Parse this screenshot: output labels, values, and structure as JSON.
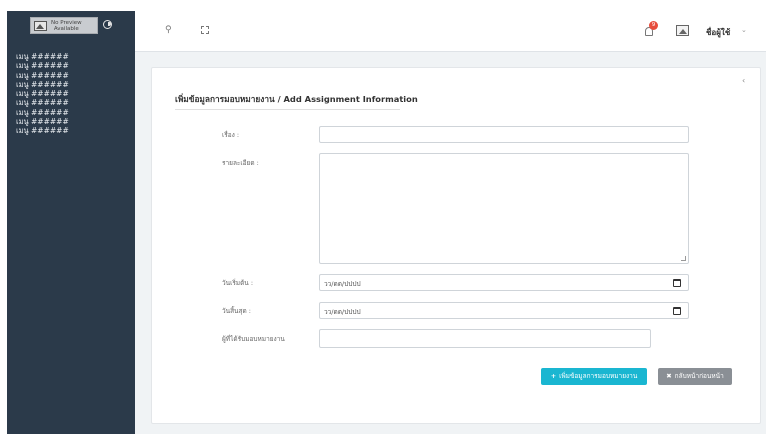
{
  "sidebar": {
    "logo_text_line1": "No Preview",
    "logo_text_line2": "Available",
    "menu_items": [
      "เมนู ######",
      "เมนู ######",
      "เมนู ######",
      "เมนู ######",
      "เมนู ######",
      "เมนู ######",
      "เมนู ######",
      "เมนู ######",
      "เมนู ######"
    ]
  },
  "topbar": {
    "notification_count": "9",
    "username": "ชื่อผู้ใช้",
    "user_caret": "⌄"
  },
  "form": {
    "title": "เพิ่มข้อมูลการมอบหมายงาน / Add Assignment Information",
    "collapse_glyph": "‹",
    "subject_label": "เรื่อง :",
    "detail_label": "รายละเอียด :",
    "start_label": "วันเริ่มต้น :",
    "start_placeholder": "วว/ดด/ปปปป",
    "end_label": "วันสิ้นสุด :",
    "end_placeholder": "วว/ดด/ปปปป",
    "assignee_label": "ผู้ที่ได้รับมอบหมายงาน",
    "add_button": "เพิ่มข้อมูลการมอบหมายงาน",
    "add_button_icon": "plus-icon",
    "back_button": "กลับหน้าก่อนหน้า",
    "back_button_icon": "close-icon"
  },
  "colors": {
    "sidebar_bg": "#2b3a4a",
    "accent": "#1ab6d1",
    "back_button": "#8a8f95",
    "badge": "#e74c3c"
  }
}
